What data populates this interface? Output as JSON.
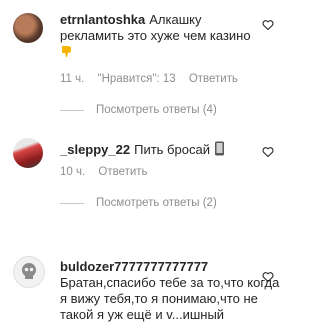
{
  "comments": [
    {
      "username": "etrnlantoshka",
      "text": "Алкашку рекламить это хуже чем казино",
      "emoji": "thumbs-down",
      "time": "11 ч.",
      "likes": "\"Нравится\": 13",
      "reply": "Ответить",
      "view_replies": "Посмотреть ответы (4)"
    },
    {
      "username": "_sleppy_22",
      "text": "Пить бросай",
      "emoji": "mobile-phone",
      "time": "10 ч.",
      "reply": "Ответить",
      "view_replies": "Посмотреть ответы (2)"
    },
    {
      "username": "buldozer7777777777777",
      "text": "Братан,спасибо тебе за то,что когда я вижу тебя,то я понимаю,что не такой я уж ещё и v...ишный"
    }
  ],
  "colors": {
    "text": "#262626",
    "secondary": "#8e8e8e",
    "emoji_thumbs": "#f5b400"
  }
}
